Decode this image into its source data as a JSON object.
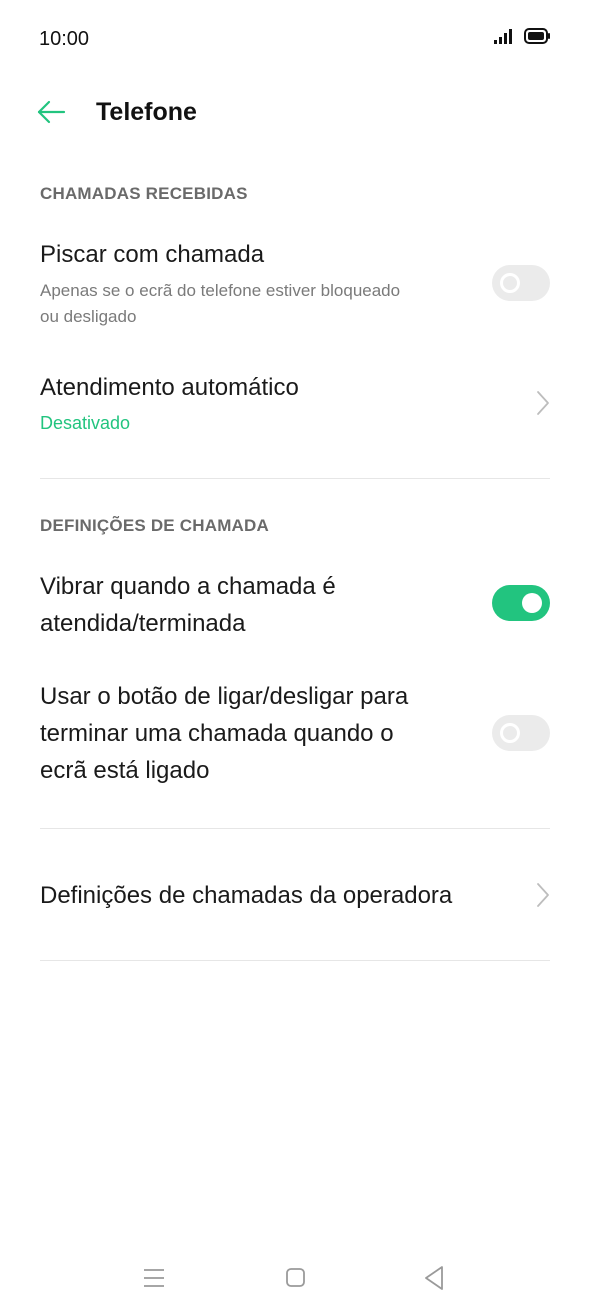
{
  "status_bar": {
    "time": "10:00",
    "signal_icon": "signal-icon",
    "battery_icon": "battery-icon"
  },
  "header": {
    "back_icon": "back-arrow-icon",
    "title": "Telefone"
  },
  "colors": {
    "accent": "#22c47f",
    "toggle_off": "#ebebeb",
    "section_header": "#6a6a6a",
    "divider": "#e6e6e6"
  },
  "sections": {
    "incoming": {
      "header": "CHAMADAS RECEBIDAS",
      "flash_on_call": {
        "title": "Piscar com chamada",
        "subtitle_line1": "Apenas se o ecrã do telefone estiver bloqueado",
        "subtitle_line2": "ou desligado",
        "enabled": false
      },
      "auto_answer": {
        "title": "Atendimento automático",
        "value": "Desativado"
      }
    },
    "call_settings": {
      "header": "DEFINIÇÕES DE CHAMADA",
      "vibrate": {
        "title_line1": "Vibrar quando a chamada é",
        "title_line2": "atendida/terminada",
        "enabled": true
      },
      "power_button_end": {
        "title_line1": "Usar o botão de ligar/desligar para",
        "title_line2": "terminar uma chamada quando o",
        "title_line3": "ecrã está ligado",
        "enabled": false
      }
    },
    "carrier": {
      "title": "Definições de chamadas da operadora"
    }
  },
  "nav_bar": {
    "menu_icon": "menu-icon",
    "home_icon": "home-icon",
    "back_icon": "back-triangle-icon"
  }
}
